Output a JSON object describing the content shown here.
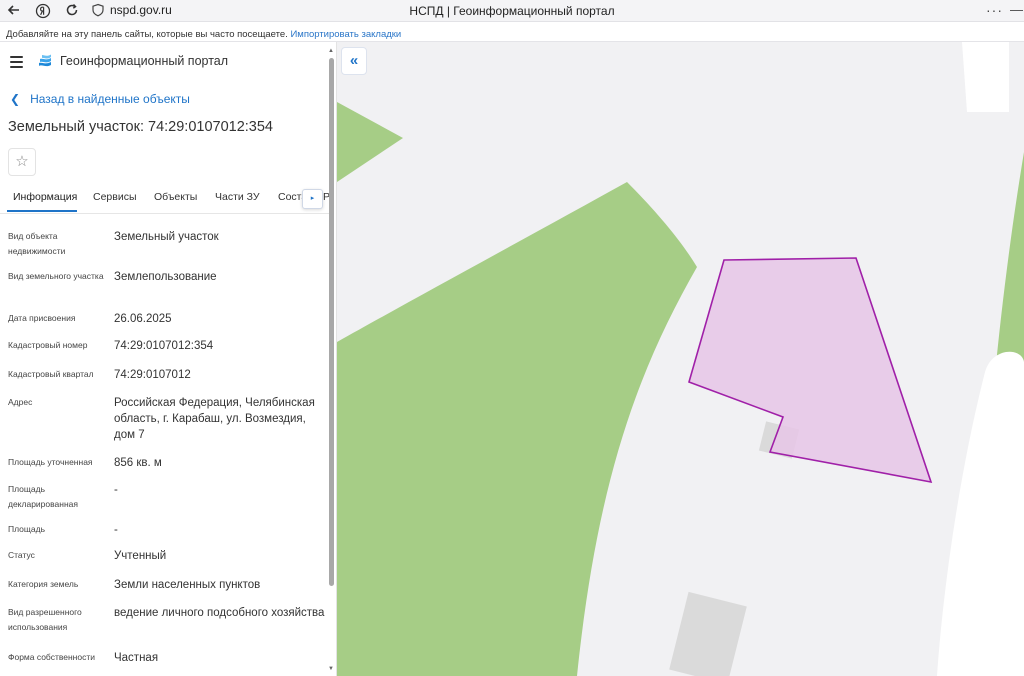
{
  "browser": {
    "url": "nspd.gov.ru",
    "tab_title": "НСПД | Геоинформационный портал",
    "more": "···",
    "minimize": "—",
    "bookmarks_text": "Добавляйте на эту панель сайты, которые вы часто посещаете.",
    "bookmarks_link": "Импортировать закладки",
    "icons": [
      "back-arrow-icon",
      "yandex-icon",
      "reload-icon",
      "shield-icon"
    ]
  },
  "panel": {
    "portal_title": "Геоинформационный портал",
    "back_label": "Назад в найденные объекты",
    "parcel_title": "Земельный участок: 74:29:0107012:354",
    "favorite_icon": "☆",
    "tabs": [
      "Информация",
      "Сервисы",
      "Объекты",
      "Части ЗУ",
      "Соста",
      "Р"
    ],
    "active_tab": "Информация",
    "tab_scroll_icon": "▸",
    "fields": [
      {
        "label": "Вид объекта недвижимости",
        "value": "Земельный участок"
      },
      {
        "label": "Вид земельного участка",
        "value": "Землепользование"
      },
      {
        "label": "Дата присвоения",
        "value": "26.06.2025"
      },
      {
        "label": "Кадастровый номер",
        "value": "74:29:0107012:354"
      },
      {
        "label": "Кадастровый квартал",
        "value": "74:29:0107012"
      },
      {
        "label": "Адрес",
        "value": "Российская Федерация, Челябинская область, г. Карабаш, ул. Возмездия, дом 7"
      },
      {
        "label": "Площадь уточненная",
        "value": "856 кв. м"
      },
      {
        "label": "Площадь декларированная",
        "value": "-"
      },
      {
        "label": "Площадь",
        "value": "-"
      },
      {
        "label": "Статус",
        "value": "Учтенный"
      },
      {
        "label": "Категория земель",
        "value": "Земли населенных пунктов"
      },
      {
        "label": "Вид разрешенного использования",
        "value": "ведение личного подсобного хозяйства"
      },
      {
        "label": "Форма собственности",
        "value": "Частная"
      }
    ]
  },
  "map": {
    "collapse_icon": "«",
    "colors": {
      "background": "#f1f1f3",
      "green": "#a6cd86",
      "road": "#ffffff",
      "building": "#dadada",
      "parcel_fill": "#e6c6e6",
      "parcel_stroke": "#a020a8"
    }
  }
}
